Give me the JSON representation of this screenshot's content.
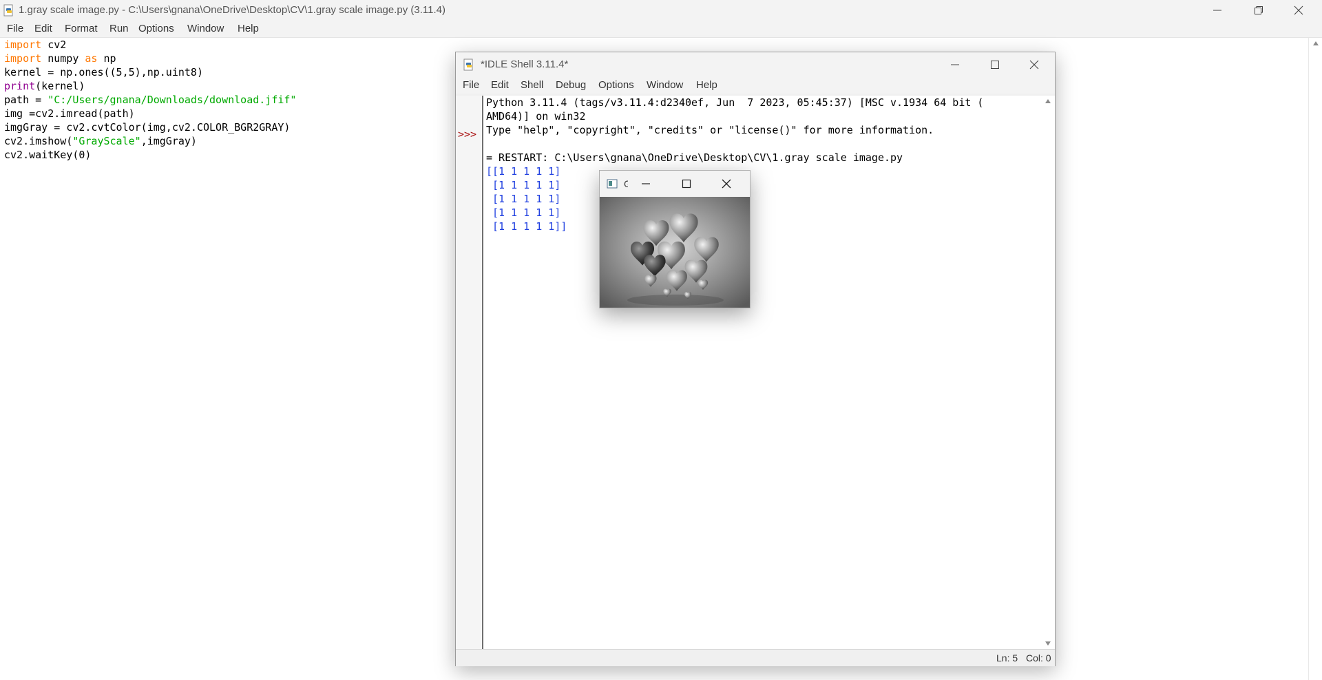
{
  "main_window": {
    "title": "1.gray scale image.py - C:\\Users\\gnana\\OneDrive\\Desktop\\CV\\1.gray scale image.py (3.11.4)",
    "menu": [
      "File",
      "Edit",
      "Format",
      "Run",
      "Options",
      "Window",
      "Help"
    ]
  },
  "code": [
    {
      "kw": "import",
      "rest": " cv2"
    },
    {
      "kw": "import",
      "mid": " numpy ",
      "kw2": "as",
      "rest": " np"
    },
    {
      "plain": "kernel = np.ones((5,5),np.uint8)"
    },
    {
      "builtin": "print",
      "rest": "(kernel)"
    },
    {
      "pre": "path = ",
      "str": "\"C:/Users/gnana/Downloads/download.jfif\""
    },
    {
      "plain": "img =cv2.imread(path)"
    },
    {
      "plain": "imgGray = cv2.cvtColor(img,cv2.COLOR_BGR2GRAY)"
    },
    {
      "pre": "cv2.imshow(",
      "str": "\"GrayScale\"",
      "post": ",imgGray)"
    },
    {
      "plain": "cv2.waitKey(0)"
    }
  ],
  "shell_window": {
    "title": "*IDLE Shell 3.11.4*",
    "menu": [
      "File",
      "Edit",
      "Shell",
      "Debug",
      "Options",
      "Window",
      "Help"
    ],
    "prompt": ">>>",
    "lines": [
      "Python 3.11.4 (tags/v3.11.4:d2340ef, Jun  7 2023, 05:45:37) [MSC v.1934 64 bit (",
      "AMD64)] on win32",
      "Type \"help\", \"copyright\", \"credits\" or \"license()\" for more information.",
      "",
      "= RESTART: C:\\Users\\gnana\\OneDrive\\Desktop\\CV\\1.gray scale image.py"
    ],
    "output": [
      "[[1 1 1 1 1]",
      " [1 1 1 1 1]",
      " [1 1 1 1 1]",
      " [1 1 1 1 1]",
      " [1 1 1 1 1]]"
    ],
    "status": {
      "line": "Ln: 5",
      "col": "Col: 0"
    }
  },
  "image_window": {
    "title": "G"
  },
  "colors": {
    "keyword": "#ff7700",
    "builtin": "#900090",
    "string": "#00aa00",
    "output": "#1f3fe0",
    "prompt": "#aa1111"
  }
}
